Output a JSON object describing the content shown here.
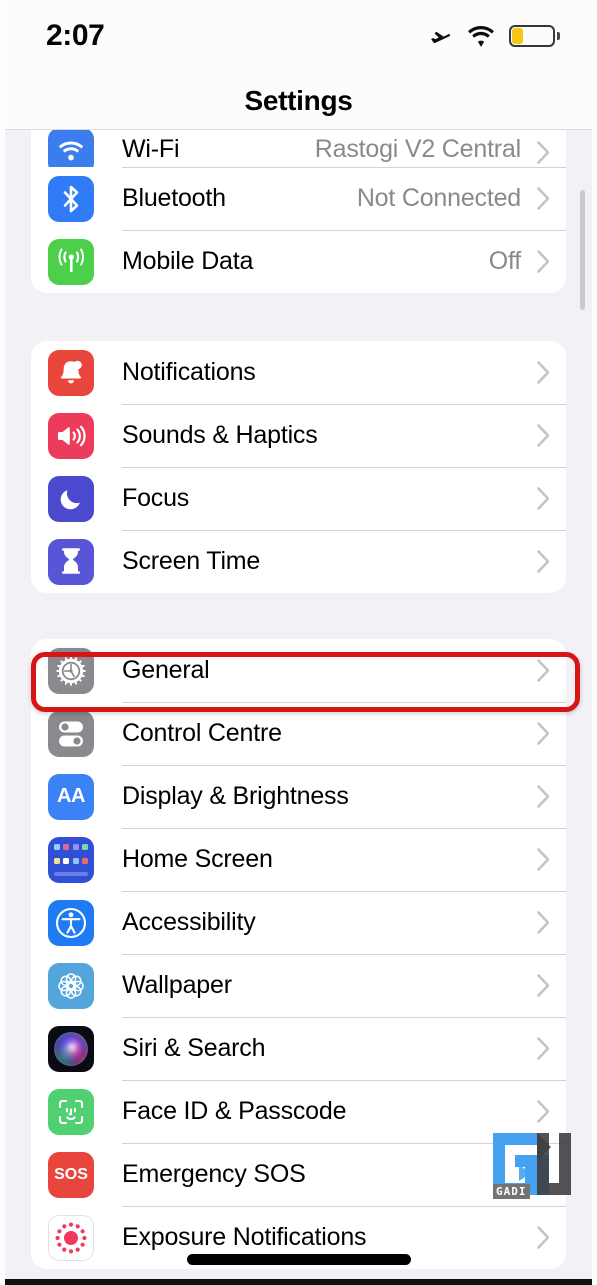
{
  "status_bar": {
    "time": "2:07",
    "icons": [
      "airplane-mode-icon",
      "wifi-icon",
      "battery-icon"
    ],
    "battery_level_percent": 30,
    "battery_color": "#F5C518"
  },
  "nav": {
    "title": "Settings"
  },
  "groups": [
    {
      "id": "connectivity",
      "rows": [
        {
          "label": "Wi-Fi",
          "value": "Rastogi V2 Central",
          "icon": "wifi-icon",
          "clipped": true
        },
        {
          "label": "Bluetooth",
          "value": "Not Connected",
          "icon": "bluetooth-icon",
          "clipped": false
        },
        {
          "label": "Mobile Data",
          "value": "Off",
          "icon": "mobile-data-icon",
          "clipped": false
        }
      ]
    },
    {
      "id": "alerts",
      "rows": [
        {
          "label": "Notifications",
          "value": "",
          "icon": "bell-icon"
        },
        {
          "label": "Sounds & Haptics",
          "value": "",
          "icon": "speaker-icon"
        },
        {
          "label": "Focus",
          "value": "",
          "icon": "moon-icon"
        },
        {
          "label": "Screen Time",
          "value": "",
          "icon": "hourglass-icon"
        }
      ]
    },
    {
      "id": "system",
      "rows": [
        {
          "label": "General",
          "value": "",
          "icon": "gear-icon",
          "highlighted": true
        },
        {
          "label": "Control Centre",
          "value": "",
          "icon": "toggles-icon"
        },
        {
          "label": "Display & Brightness",
          "value": "",
          "icon": "text-size-icon"
        },
        {
          "label": "Home Screen",
          "value": "",
          "icon": "app-grid-icon"
        },
        {
          "label": "Accessibility",
          "value": "",
          "icon": "accessibility-icon"
        },
        {
          "label": "Wallpaper",
          "value": "",
          "icon": "flower-icon"
        },
        {
          "label": "Siri & Search",
          "value": "",
          "icon": "siri-orb-icon"
        },
        {
          "label": "Face ID & Passcode",
          "value": "",
          "icon": "face-id-icon"
        },
        {
          "label": "Emergency SOS",
          "value": "",
          "icon": "sos-icon"
        },
        {
          "label": "Exposure Notifications",
          "value": "",
          "icon": "exposure-icon"
        }
      ]
    }
  ],
  "annotation": {
    "target": "General",
    "color": "#D81515",
    "shape": "rounded-rectangle"
  },
  "watermark": {
    "text": "GADI",
    "colors": [
      "#3FA0F0",
      "#3A3A3C"
    ]
  },
  "colors": {
    "background": "#F2F1F6",
    "card": "#FFFFFF",
    "separator": "#D3D3D6",
    "label": "#000000",
    "value": "#8A8A8E",
    "chevron": "#C4C4C6"
  }
}
